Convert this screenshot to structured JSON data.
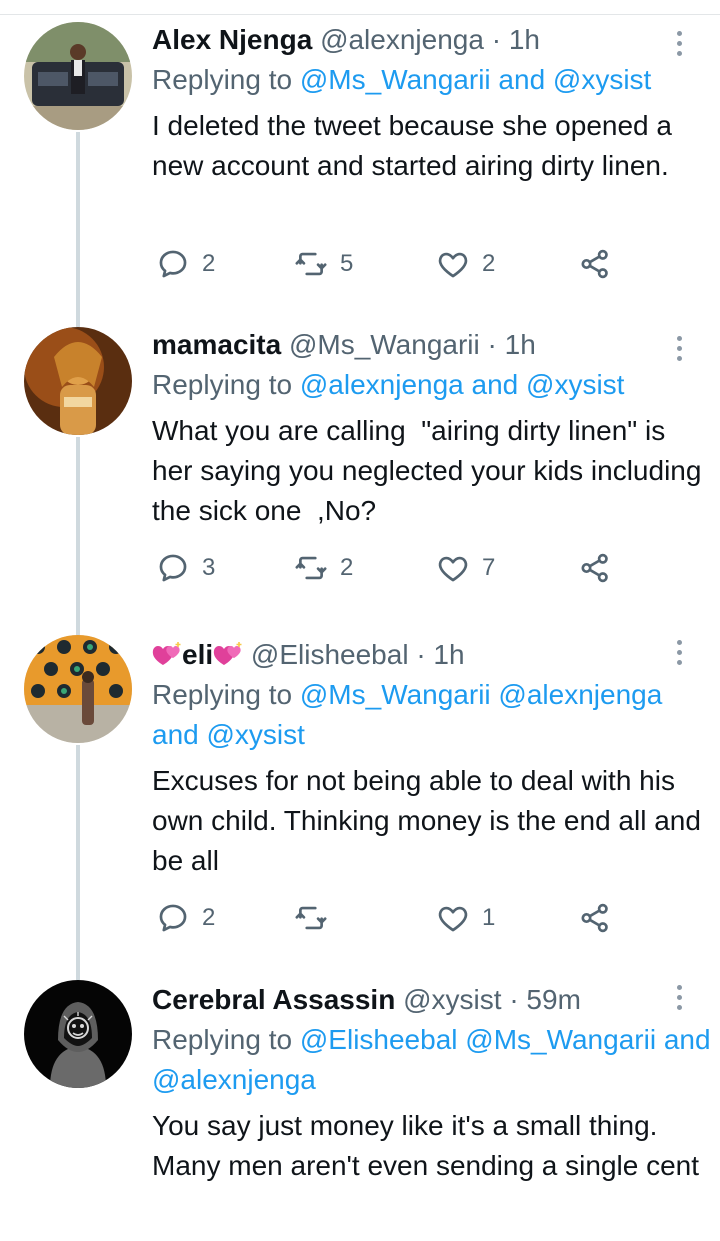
{
  "tweets": [
    {
      "name": "Alex Njenga",
      "handle": "@alexnjenga",
      "time": "· 1h",
      "replying_prefix": "Replying to",
      "replying_mentions": "@Ms_Wangarii and @xysist",
      "text": "I deleted the tweet because she opened a new account and started airing dirty linen.",
      "replies": "2",
      "retweets": "5",
      "likes": "2"
    },
    {
      "name": "mamacita",
      "handle": "@Ms_Wangarii",
      "time": "· 1h",
      "replying_prefix": "Replying to",
      "replying_mentions": "@alexnjenga and @xysist",
      "text": "What you are calling  \"airing dirty linen\" is her saying you neglected your kids including the sick one  ,No?",
      "replies": "3",
      "retweets": "2",
      "likes": "7"
    },
    {
      "name": "eli",
      "handle": "@Elisheebal",
      "time": "· 1h",
      "replying_prefix": "Replying to",
      "replying_mentions": "@Ms_Wangarii @alexnjenga and @xysist",
      "text": "Excuses for not being able to deal with his own child. Thinking money is the end all and be all",
      "replies": "2",
      "retweets": "",
      "likes": "1"
    },
    {
      "name": "Cerebral Assassin",
      "handle": "@xysist",
      "time": "· 59m",
      "replying_prefix": "Replying to",
      "replying_mentions": "@Elisheebal @Ms_Wangarii and @alexnjenga",
      "text": "You say just money like it's a small thing. Many men aren't even sending a single cent"
    }
  ],
  "icons": {
    "reply": "reply-icon",
    "retweet": "retweet-icon",
    "like": "heart-icon",
    "share": "share-icon",
    "more": "more-icon"
  },
  "colors": {
    "mention": "#1d9bf0",
    "secondary": "#536471",
    "thread_line": "#cfd9de",
    "emoji_heart": "#e0409a"
  }
}
